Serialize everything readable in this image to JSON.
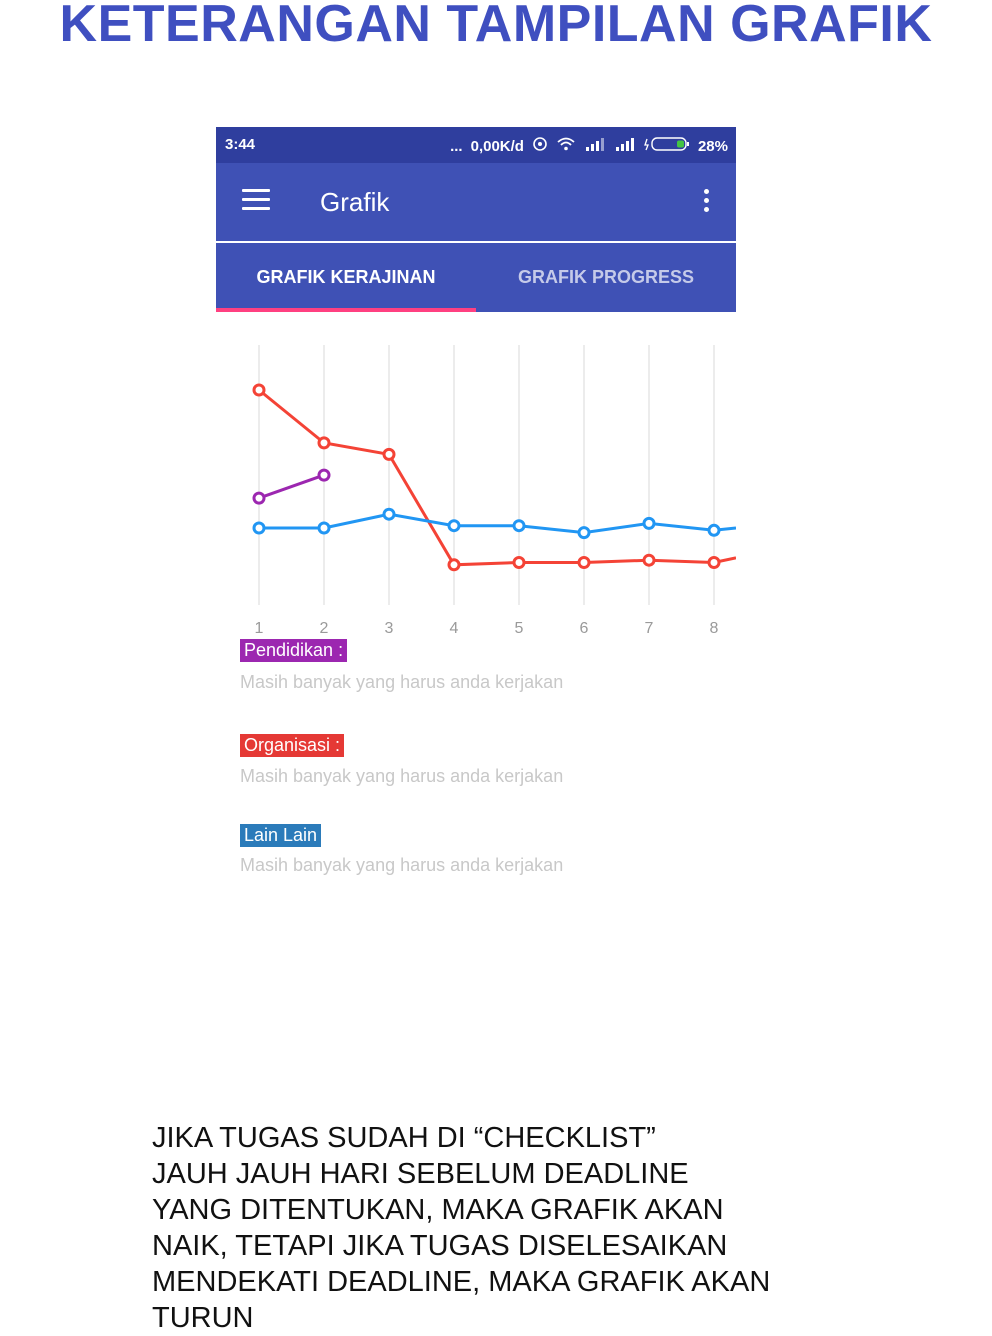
{
  "page_title": "KETERANGAN TAMPILAN GRAFIK",
  "status_bar": {
    "time": "3:44",
    "speed": "0,00K/d",
    "battery": "28%",
    "dots": "..."
  },
  "app_bar": {
    "title": "Grafik",
    "menu_icon": "hamburger-icon",
    "overflow_icon": "more-vert-icon"
  },
  "tabs": [
    {
      "label": "GRAFIK KERAJINAN",
      "active": true
    },
    {
      "label": "GRAFIK PROGRESS",
      "active": false
    }
  ],
  "colors": {
    "pendidikan": "#9c27b0",
    "organisasi": "#f44336",
    "lain_lain": "#2196f3",
    "legend_lain_bg": "#2b7bba",
    "legend_pendidikan_bg": "#9c27b0",
    "legend_organisasi_bg": "#e53935"
  },
  "chart_data": {
    "type": "line",
    "x": [
      1,
      2,
      3,
      4,
      5,
      6,
      7,
      8
    ],
    "series": [
      {
        "name": "Pendidikan",
        "values": [
          53,
          63,
          null,
          null,
          null,
          null,
          null,
          null
        ]
      },
      {
        "name": "Organisasi",
        "values": [
          100,
          77,
          72,
          24,
          25,
          25,
          26,
          25
        ]
      },
      {
        "name": "Lain Lain",
        "values": [
          40,
          40,
          46,
          41,
          41,
          38,
          42,
          39
        ]
      }
    ],
    "grid": "vertical",
    "legend": "below"
  },
  "legend": [
    {
      "label": "Pendidikan :",
      "desc": "Masih banyak yang harus anda kerjakan"
    },
    {
      "label": "Organisasi :",
      "desc": "Masih banyak yang harus anda kerjakan"
    },
    {
      "label": "Lain Lain",
      "desc": "Masih banyak yang harus anda kerjakan"
    }
  ],
  "caption": [
    "JIKA TUGAS SUDAH DI “CHECKLIST”",
    "JAUH JAUH HARI SEBELUM DEADLINE",
    "YANG DITENTUKAN, MAKA GRAFIK AKAN",
    "NAIK, TETAPI JIKA TUGAS DISELESAIKAN",
    "MENDEKATI DEADLINE, MAKA GRAFIK AKAN",
    "TURUN"
  ]
}
